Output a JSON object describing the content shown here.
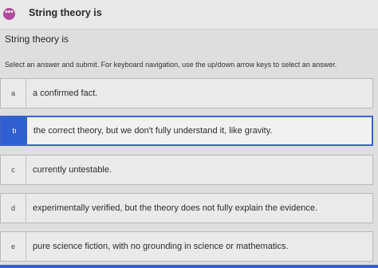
{
  "header": {
    "icon": "ellipsis-icon",
    "icon_glyph": "•••",
    "title": "String theory is"
  },
  "question": {
    "title": "String theory is",
    "instructions": "Select an answer and submit. For keyboard navigation, use the up/down arrow keys to select an answer."
  },
  "options": [
    {
      "letter": "a",
      "text": "a confirmed fact."
    },
    {
      "letter": "b",
      "text": "the correct theory, but we don't fully understand it, like gravity."
    },
    {
      "letter": "c",
      "text": "currently untestable."
    },
    {
      "letter": "d",
      "text": "experimentally verified, but the theory does not fully explain the evidence."
    },
    {
      "letter": "e",
      "text": "pure science fiction, with no grounding in science or mathematics."
    }
  ],
  "selected_option": "b",
  "colors": {
    "accent": "#2f5fd0",
    "icon_bg": "#b14a9b"
  }
}
